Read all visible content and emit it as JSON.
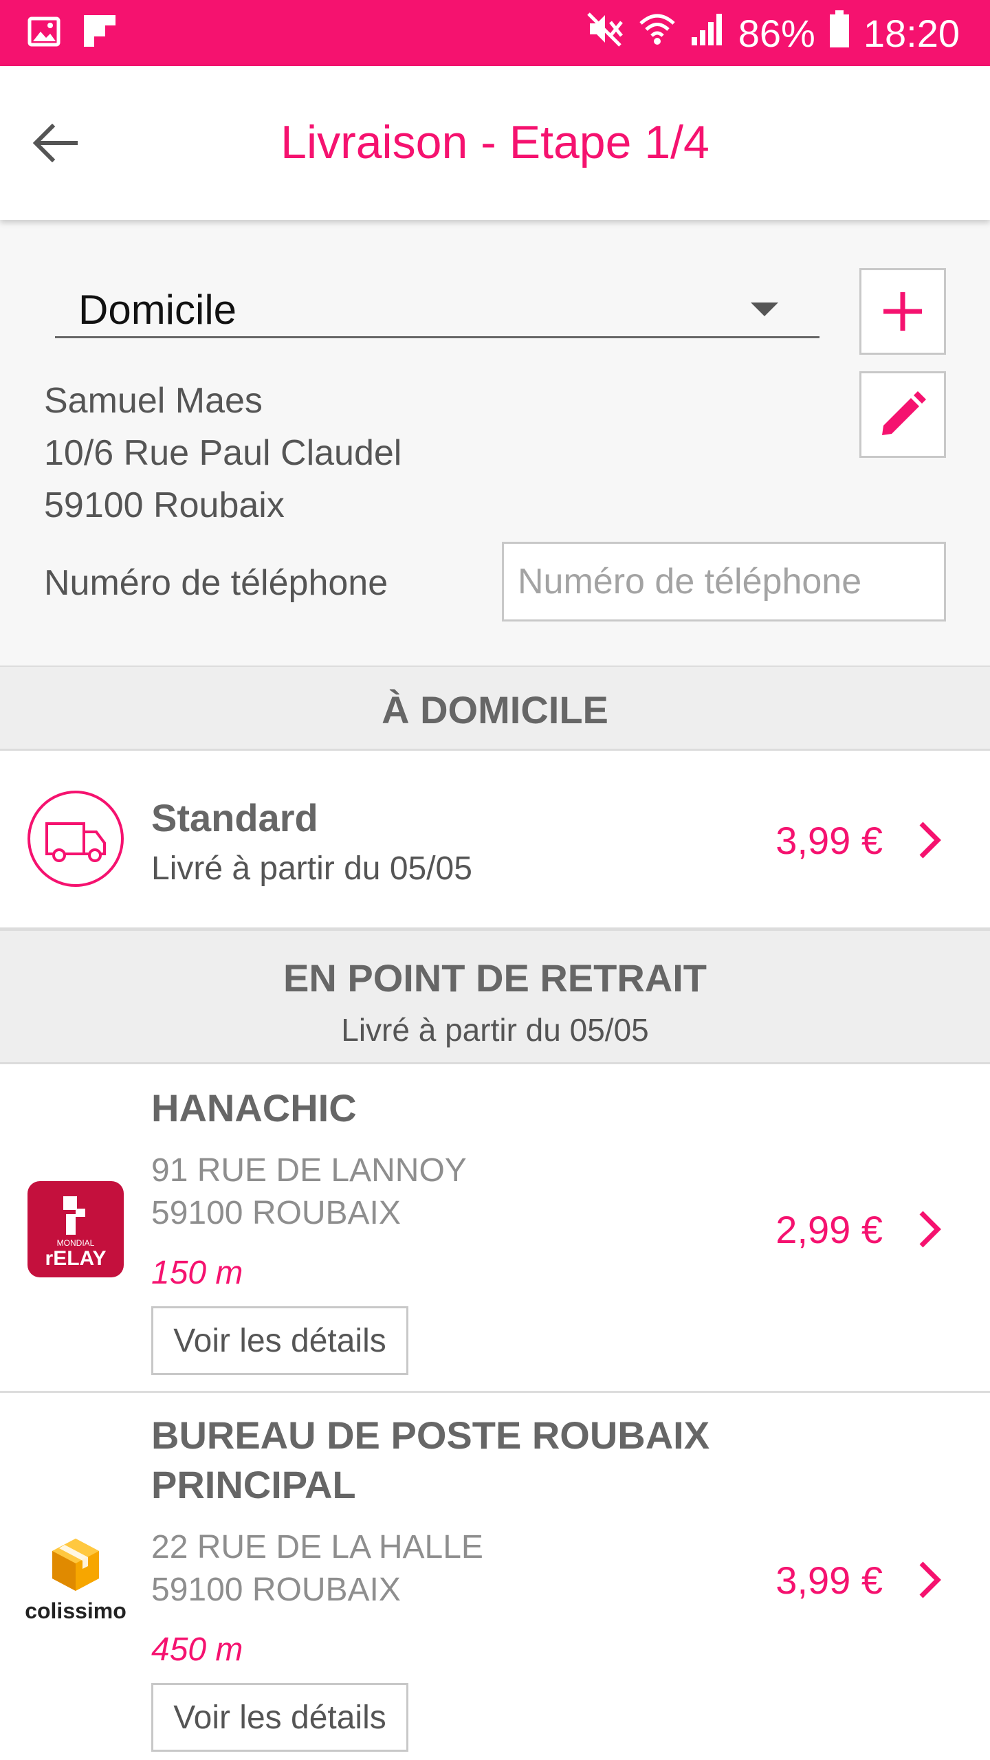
{
  "status_bar": {
    "battery": "86%",
    "time": "18:20",
    "icons": [
      "gallery-icon",
      "flipboard-icon",
      "mute-icon",
      "wifi-icon",
      "signal-icon",
      "battery-icon"
    ]
  },
  "header": {
    "title": "Livraison - Etape 1/4",
    "back_icon": "arrow-left-icon"
  },
  "address": {
    "selected": "Domicile",
    "add_icon": "plus-icon",
    "edit_icon": "pencil-icon",
    "name": "Samuel Maes",
    "street": "10/6 Rue Paul Claudel",
    "city": "59100 Roubaix",
    "phone_label": "Numéro de téléphone",
    "phone_placeholder": "Numéro de téléphone",
    "phone_value": ""
  },
  "home_delivery": {
    "title": "À DOMICILE",
    "option": {
      "name": "Standard",
      "subtitle": "Livré à partir du 05/05",
      "price": "3,99 €",
      "icon": "truck-icon"
    }
  },
  "pickup": {
    "title": "EN POINT DE RETRAIT",
    "subtitle": "Livré à partir du 05/05",
    "points": [
      {
        "name": "HANACHIC",
        "address_line1": "91 RUE DE LANNOY",
        "address_line2": "59100 ROUBAIX",
        "distance": "150 m",
        "details_label": "Voir les détails",
        "price": "2,99 €",
        "logo": "mondial-relay-logo",
        "logo_text_top": "MONDIAL",
        "logo_text_bottom": "rELAY"
      },
      {
        "name_line1": "BUREAU DE POSTE ROUBAIX",
        "name_line2": "PRINCIPAL",
        "address_line1": "22 RUE DE LA HALLE",
        "address_line2": "59100 ROUBAIX",
        "distance": "450 m",
        "details_label": "Voir les détails",
        "price": "3,99 €",
        "logo": "colissimo-logo",
        "logo_text": "colissimo"
      }
    ]
  },
  "colors": {
    "accent": "#f5126f",
    "text_gray": "#666666",
    "section_bg": "#eeeeee",
    "colissimo_orange": "#f7a600",
    "relay_red": "#c4103d"
  }
}
